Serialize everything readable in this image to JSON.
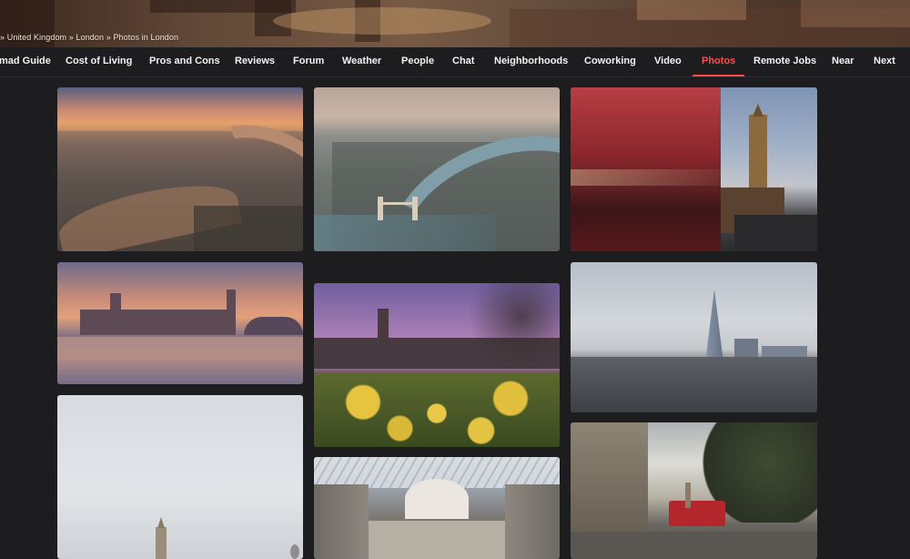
{
  "breadcrumb": {
    "prefix": "»",
    "items": [
      "United Kingdom",
      "London",
      "Photos in London"
    ],
    "separator": "»"
  },
  "nav": {
    "items": [
      {
        "label": "mad Guide"
      },
      {
        "label": "Cost of Living"
      },
      {
        "label": "Pros and Cons"
      },
      {
        "label": "Reviews"
      },
      {
        "label": "Forum"
      },
      {
        "label": "Weather"
      },
      {
        "label": "People"
      },
      {
        "label": "Chat"
      },
      {
        "label": "Neighborhoods"
      },
      {
        "label": "Coworking"
      },
      {
        "label": "Video"
      },
      {
        "label": "Photos",
        "active": true
      },
      {
        "label": "Remote Jobs"
      },
      {
        "label": "Near"
      },
      {
        "label": "Next"
      }
    ],
    "active_color": "#ff4a4a"
  },
  "photos": [
    {
      "subject": "London aerial sunset over Thames"
    },
    {
      "subject": "London aerial Tower Bridge river"
    },
    {
      "subject": "Red bus motion blur Big Ben"
    },
    {
      "subject": "Westminster Palace sunset"
    },
    {
      "subject": "Big Ben with daffodils"
    },
    {
      "subject": "The Shard skyline"
    },
    {
      "subject": "Big Ben misty sky"
    },
    {
      "subject": "British Museum Great Court"
    },
    {
      "subject": "London street with red bus"
    }
  ]
}
